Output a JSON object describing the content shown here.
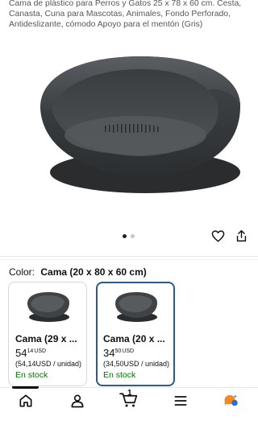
{
  "product": {
    "title": "Cama de plástico para Perros y Gatos 25 x 78 x 60 cm. Cesta, Canasta, Cuna para Mascotas, Animales, Fondo Perforado, Antideslizante, cómodo Apoyo para el mentón (Gris)",
    "image_count": 2,
    "active_image": 1
  },
  "variation": {
    "label": "Color:",
    "selected": "Cama (20 x 80 x 60 cm)",
    "options": [
      {
        "name": "Cama (29 x ...",
        "price_whole": "54",
        "price_fraction": "14",
        "currency": "USD",
        "unit_price": "(54,14USD / unidad)",
        "stock": "En stock",
        "selected": false
      },
      {
        "name": "Cama (20 x ...",
        "price_whole": "34",
        "price_fraction": "50",
        "currency": "USD",
        "unit_price": "(34,50USD / unidad)",
        "stock": "En stock",
        "selected": true
      }
    ]
  },
  "nav": {
    "cart_count": "1",
    "active_tab": "home"
  },
  "colors": {
    "selected_border": "#2e5a88",
    "in_stock": "#007600",
    "bed_gray": "#4a4e52"
  },
  "icons": [
    "heart-icon",
    "share-icon",
    "home-icon",
    "account-icon",
    "cart-icon",
    "menu-icon",
    "rufus-icon"
  ]
}
